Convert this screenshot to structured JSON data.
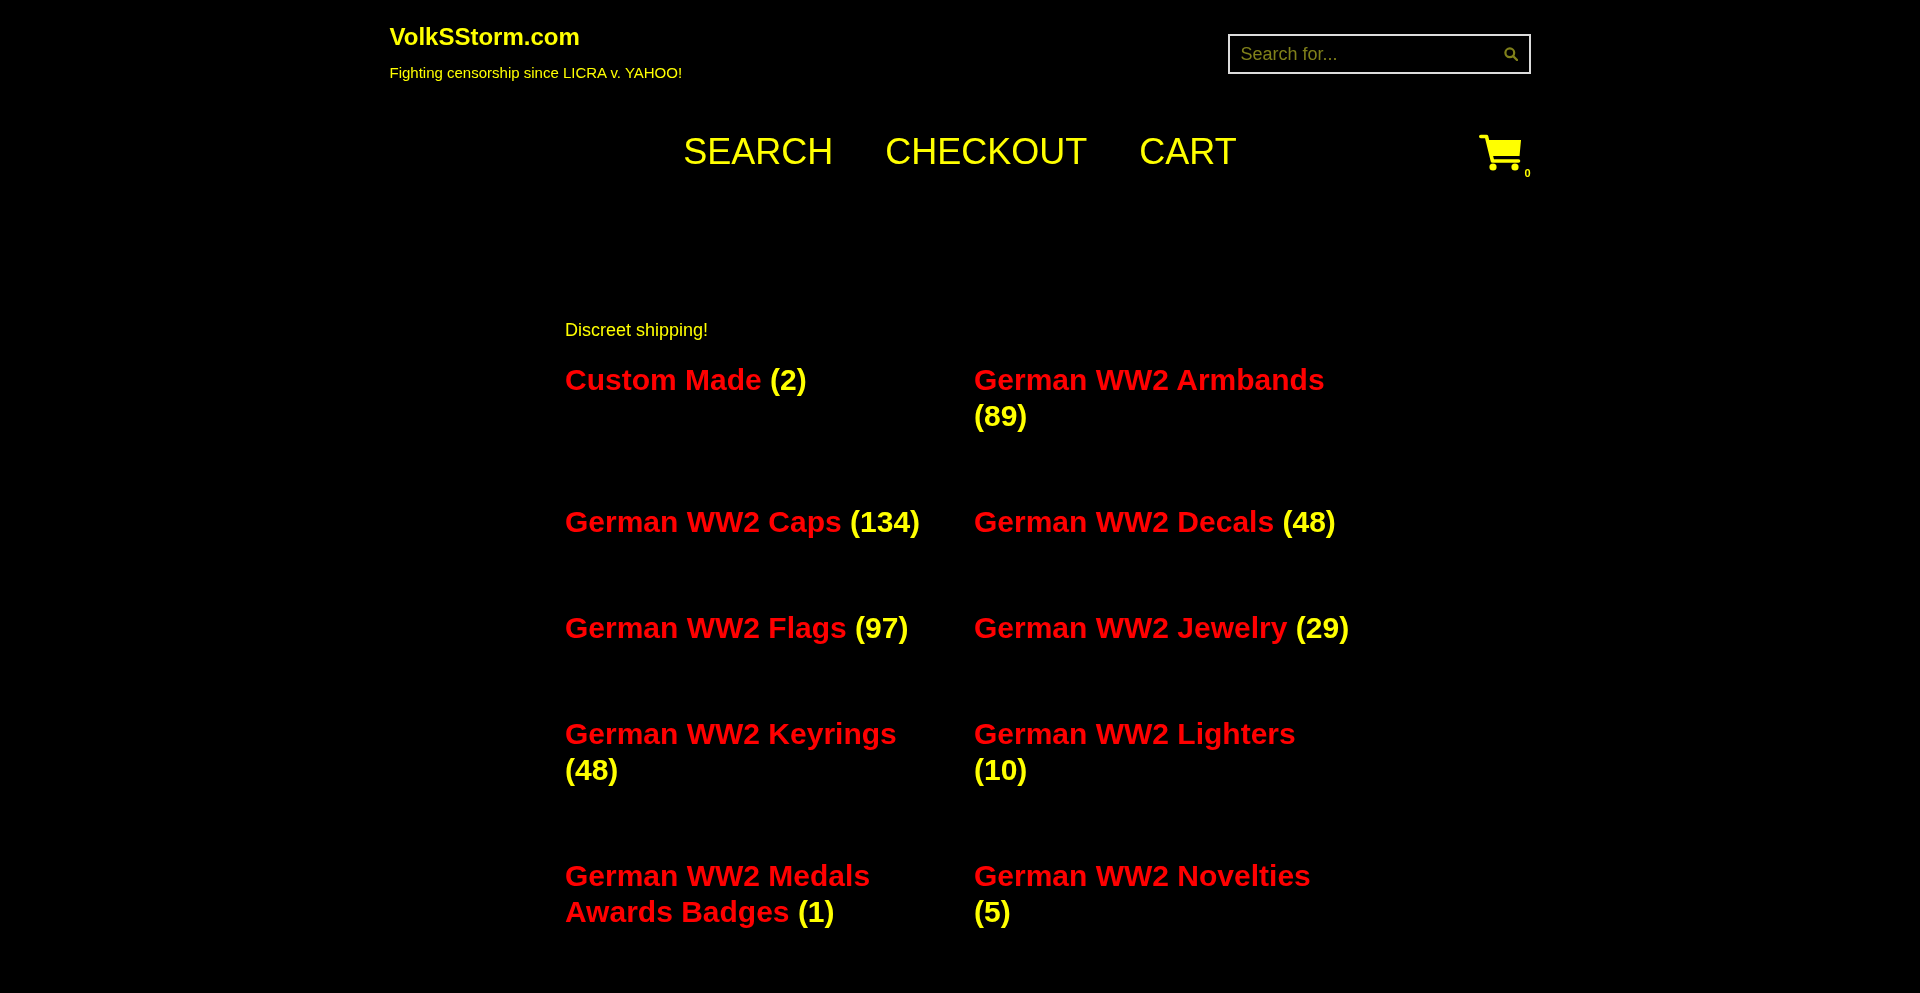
{
  "site": {
    "title": "VolkSStorm.com",
    "tagline": "Fighting censorship since LICRA v. YAHOO!"
  },
  "search": {
    "placeholder": "Search for..."
  },
  "nav": [
    "SEARCH",
    "CHECKOUT",
    "CART"
  ],
  "cart": {
    "count": "0"
  },
  "notice": "Discreet shipping!",
  "categories": [
    {
      "name": "Custom Made",
      "count": "(2)"
    },
    {
      "name": "German WW2 Armbands",
      "count": "(89)"
    },
    {
      "name": "German WW2 Caps",
      "count": "(134)"
    },
    {
      "name": "German WW2 Decals",
      "count": "(48)"
    },
    {
      "name": "German WW2 Flags",
      "count": "(97)"
    },
    {
      "name": "German WW2 Jewelry",
      "count": "(29)"
    },
    {
      "name": "German WW2 Keyrings",
      "count": "(48)"
    },
    {
      "name": "German WW2 Lighters",
      "count": "(10)"
    },
    {
      "name": "German WW2 Medals Awards Badges",
      "count": "(1)"
    },
    {
      "name": "German WW2 Novelties",
      "count": "(5)"
    }
  ]
}
